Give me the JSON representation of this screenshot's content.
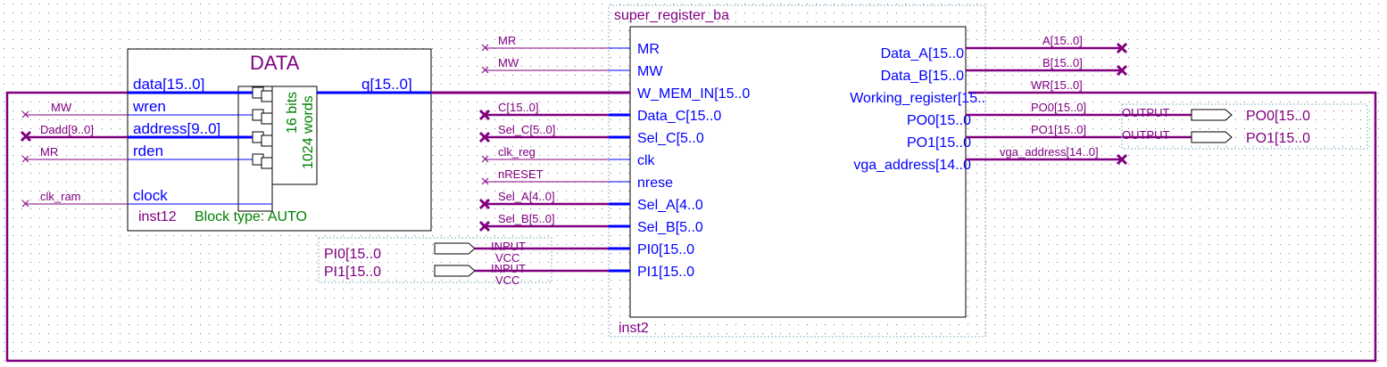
{
  "colors": {
    "wire": "#800080",
    "blue": "#0000ff",
    "box": "#000000",
    "green": "#008000",
    "dotted": "#8ab4c8"
  },
  "ram": {
    "title": "DATA",
    "ports_in": [
      "data[15..0]",
      "wren",
      "address[9..0]",
      "rden",
      "clock"
    ],
    "port_out": "q[15..0]",
    "bits": "16 bits",
    "words": "1024 words",
    "instance": "inst12",
    "block_type": "Block type: AUTO"
  },
  "ram_inputs": {
    "mw": "MW",
    "dadd": "Dadd[9..0]",
    "mr": "MR",
    "clk_ram": "clk_ram"
  },
  "regbank": {
    "title": "super_register_ba",
    "instance": "inst2",
    "ports_left": [
      "MR",
      "MW",
      "W_MEM_IN[15..0",
      "Data_C[15..0",
      "Sel_C[5..0",
      "clk",
      "nrese",
      "Sel_A[4..0",
      "Sel_B[5..0",
      "PI0[15..0",
      "PI1[15..0"
    ],
    "ports_right": [
      "Data_A[15..0",
      "Data_B[15..0",
      "Working_register[15..",
      "PO0[15..0",
      "PO1[15..0",
      "vga_address[14..0"
    ]
  },
  "left_nets": [
    "MR",
    "MW",
    "C[15..0]",
    "Sel_C[5..0]",
    "clk_reg",
    "nRESET",
    "Sel_A[4..0]",
    "Sel_B[5..0]"
  ],
  "right_nets": [
    "A[15..0]",
    "B[15..0]",
    "WR[15..0]",
    "PO0[15..0]",
    "PO1[15..0]",
    "vga_address[14..0]"
  ],
  "inputs": [
    {
      "name": "PI0[15..0",
      "type": "INPUT",
      "vcc": "VCC"
    },
    {
      "name": "PI1[15..0",
      "type": "INPUT",
      "vcc": "VCC"
    }
  ],
  "outputs": [
    {
      "name": "PO0[15..0",
      "type": "OUTPUT"
    },
    {
      "name": "PO1[15..0",
      "type": "OUTPUT"
    }
  ]
}
